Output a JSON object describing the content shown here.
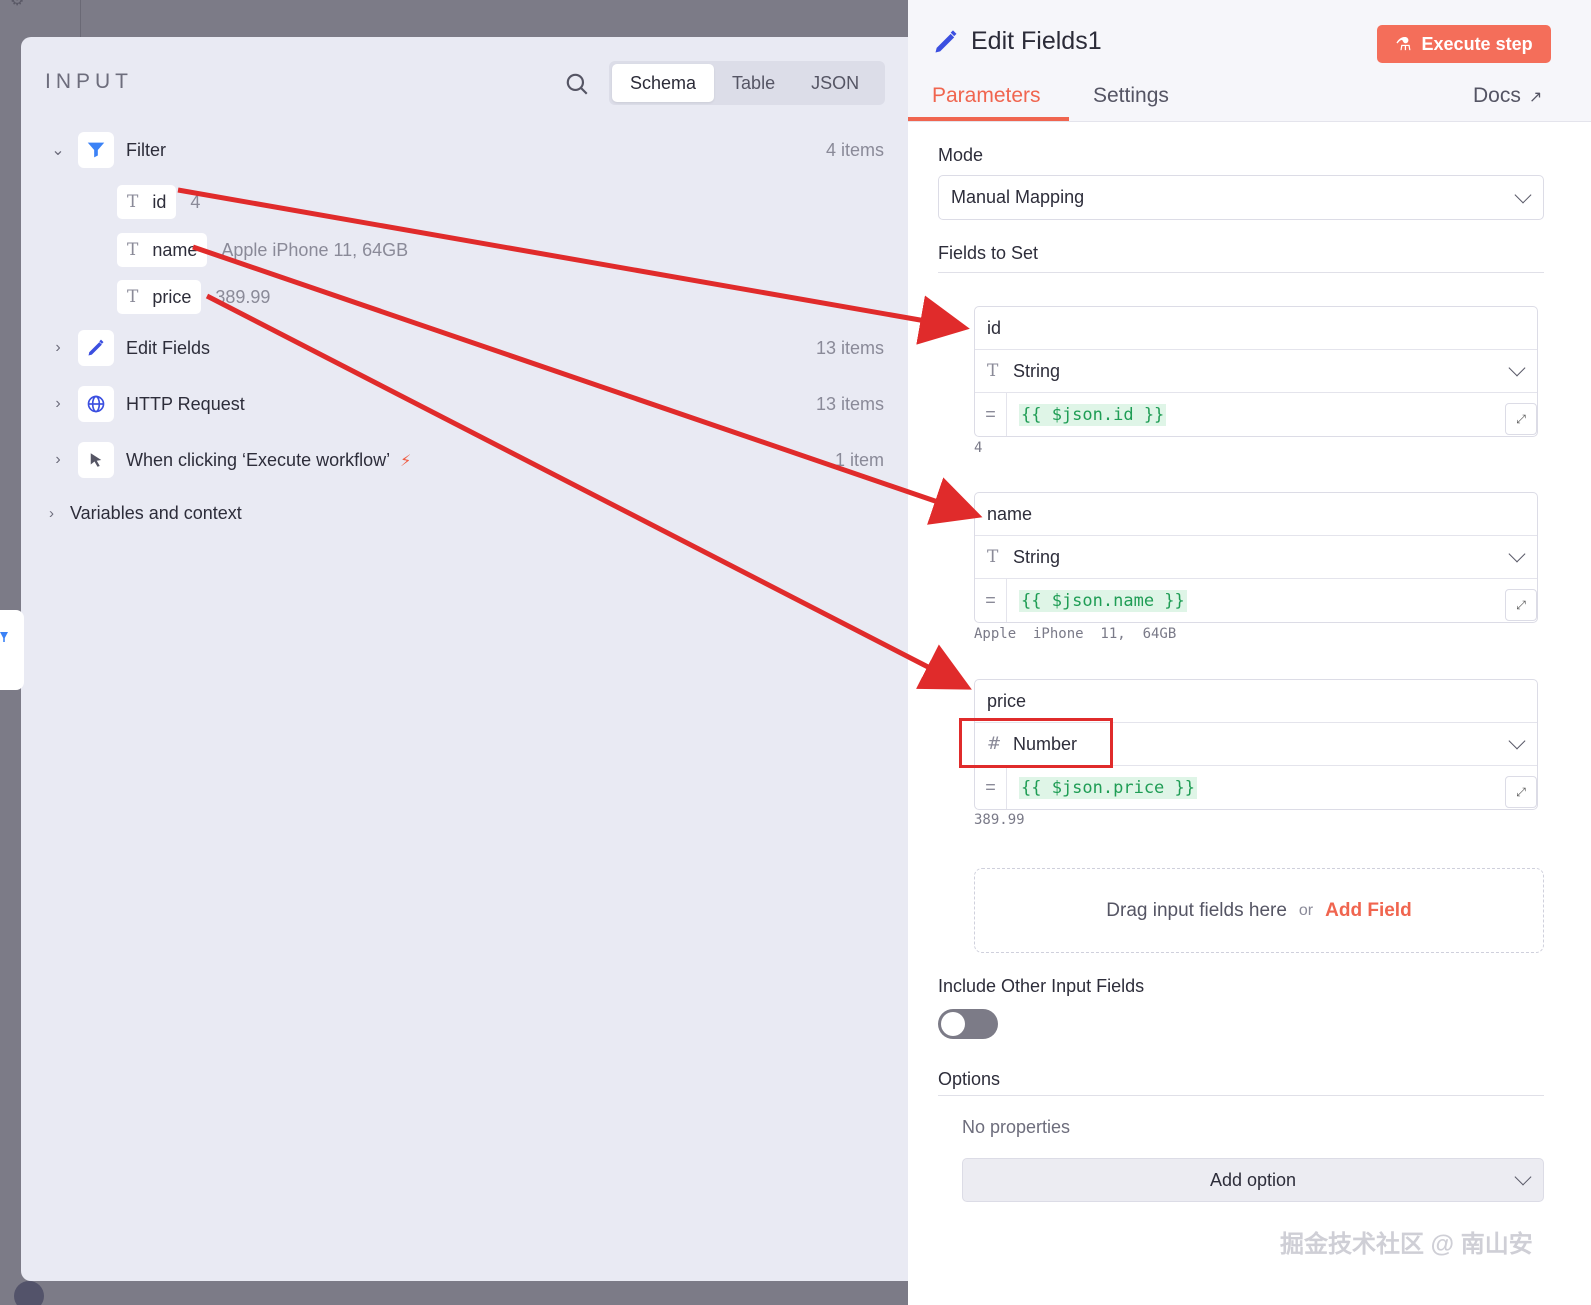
{
  "input_panel": {
    "title": "INPUT",
    "view_tabs": [
      "Schema",
      "Table",
      "JSON"
    ],
    "active_view": "Schema",
    "nodes": [
      {
        "label": "Filter",
        "count": "4 items",
        "icon": "filter-icon",
        "expanded": true
      },
      {
        "label": "Edit Fields",
        "count": "13 items",
        "icon": "pencil-icon",
        "expanded": false
      },
      {
        "label": "HTTP Request",
        "count": "13 items",
        "icon": "globe-icon",
        "expanded": false
      },
      {
        "label": "When clicking ‘Execute workflow’",
        "count": "1 item",
        "icon": "cursor-icon",
        "expanded": false
      }
    ],
    "fields": [
      {
        "type_glyph": "T",
        "name": "id",
        "value": "4"
      },
      {
        "type_glyph": "T",
        "name": "name",
        "value": "Apple iPhone 11, 64GB"
      },
      {
        "type_glyph": "T",
        "name": "price",
        "value": "389.99"
      }
    ],
    "variables_label": "Variables and context"
  },
  "node_panel": {
    "title": "Edit Fields1",
    "execute_label": "Execute step",
    "tabs": [
      "Parameters",
      "Settings"
    ],
    "active_tab": "Parameters",
    "docs_label": "Docs",
    "mode_label": "Mode",
    "mode_value": "Manual Mapping",
    "fields_to_set_label": "Fields to Set",
    "assignments": [
      {
        "name": "id",
        "type_glyph": "T",
        "type": "String",
        "expression": "{{ $json.id }}",
        "preview": "4"
      },
      {
        "name": "name",
        "type_glyph": "T",
        "type": "String",
        "expression": "{{ $json.name }}",
        "preview": "Apple  iPhone  11,  64GB"
      },
      {
        "name": "price",
        "type_glyph": "#",
        "type": "Number",
        "expression": "{{ $json.price }}",
        "preview": "389.99"
      }
    ],
    "drop_hint": "Drag input fields here",
    "or_label": "or",
    "add_field_label": "Add Field",
    "include_other_label": "Include Other Input Fields",
    "include_other_on": false,
    "options_label": "Options",
    "no_properties": "No properties",
    "add_option_label": "Add option"
  },
  "watermark": "掘金技术社区 @ 南山安",
  "colors": {
    "accent": "#f0654f",
    "annotation": "#e02b2b",
    "expression_green": "#1f9d55"
  }
}
